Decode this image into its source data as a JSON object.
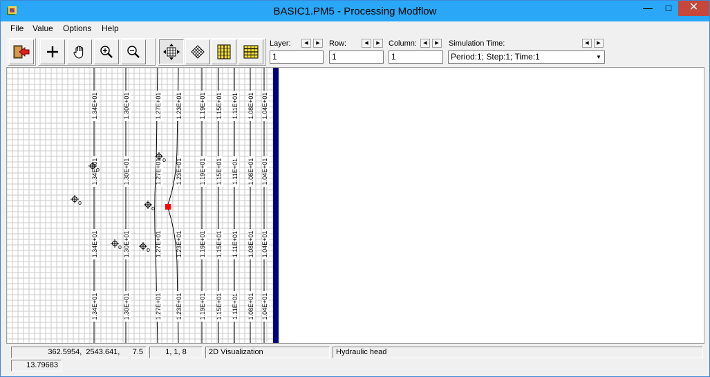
{
  "window": {
    "title": "BASIC1.PM5 - Processing Modflow",
    "minimize_glyph": "—",
    "maximize_glyph": "□",
    "close_glyph": "✕"
  },
  "menu": {
    "items": [
      "File",
      "Value",
      "Options",
      "Help"
    ]
  },
  "toolbar": {
    "buttons": [
      {
        "name": "exit-icon"
      },
      {
        "name": "plus-icon"
      },
      {
        "name": "pan-hand-icon"
      },
      {
        "name": "zoom-in-icon"
      },
      {
        "name": "zoom-out-icon"
      },
      {
        "name": "move-grid-icon",
        "pressed": true
      },
      {
        "name": "rotate-grid-icon"
      },
      {
        "name": "grid-columns-icon"
      },
      {
        "name": "grid-rows-icon"
      }
    ],
    "layer": {
      "label": "Layer:",
      "value": "1"
    },
    "row": {
      "label": "Row:",
      "value": "1"
    },
    "column": {
      "label": "Column:",
      "value": "1"
    },
    "simulation_time": {
      "label": "Simulation Time:",
      "value": "Period:1; Step:1; Time:1"
    },
    "spin_left": "◀",
    "spin_right": "▶",
    "combo_arrow": "▼"
  },
  "colors": {
    "title_bg": "#2aa7f7",
    "close_bg": "#c7473a",
    "grid_line": "#c8c8c8",
    "boundary": "#000080",
    "active_cell": "#ff0000"
  },
  "contours": [
    {
      "label": "1.34E+01"
    },
    {
      "label": "1.30E+01"
    },
    {
      "label": "1.27E+01"
    },
    {
      "label": "1.23E+01"
    },
    {
      "label": "1.19E+01"
    },
    {
      "label": "1.15E+01"
    },
    {
      "label": "1.11E+01"
    },
    {
      "label": "1.08E+01"
    },
    {
      "label": "1.04E+01"
    }
  ],
  "well_label": "o",
  "status": {
    "coordinates": "362.5954,  2543.641,      7.5",
    "cell": "1, 1, 8",
    "mode": "2D Visualization",
    "parameter": "Hydraulic head",
    "value": "13.79683"
  }
}
